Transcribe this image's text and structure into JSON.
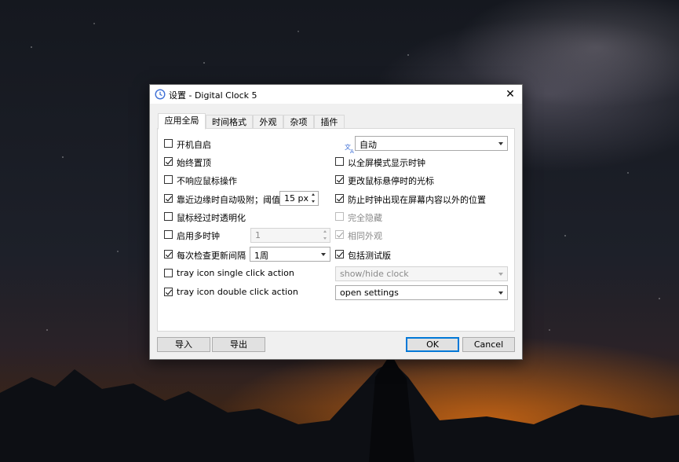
{
  "window": {
    "title": "设置 - Digital Clock 5",
    "close_glyph": "✕"
  },
  "tabs": [
    {
      "label": "应用全局",
      "active": true
    },
    {
      "label": "时间格式",
      "active": false
    },
    {
      "label": "外观",
      "active": false
    },
    {
      "label": "杂项",
      "active": false
    },
    {
      "label": "插件",
      "active": false
    }
  ],
  "left": {
    "autostart": {
      "label": "开机自启",
      "checked": false
    },
    "always_on_top": {
      "label": "始终置顶",
      "checked": true
    },
    "ignore_mouse": {
      "label": "不响应鼠标操作",
      "checked": false
    },
    "snap_to_edge": {
      "label": "靠近边缘时自动吸附；阈值",
      "checked": true,
      "threshold": "15 px"
    },
    "hover_transparent": {
      "label": "鼠标经过时透明化",
      "checked": false
    },
    "multi_clock": {
      "label": "启用多时钟",
      "checked": false,
      "count": "1"
    },
    "check_updates": {
      "label": "每次检查更新间隔",
      "checked": true,
      "interval": "1周"
    },
    "tray_single": {
      "label": "tray icon single click action",
      "checked": false
    },
    "tray_double": {
      "label": "tray icon double click action",
      "checked": true
    }
  },
  "right": {
    "language": {
      "value": "自动"
    },
    "fullscreen_show": {
      "label": "以全屏模式显示时钟",
      "checked": false
    },
    "change_cursor": {
      "label": "更改鼠标悬停时的光标",
      "checked": true
    },
    "keep_on_screen": {
      "label": "防止时钟出现在屏幕内容以外的位置",
      "checked": true
    },
    "fully_hide": {
      "label": "完全隐藏",
      "checked": false,
      "disabled": true
    },
    "same_appearance": {
      "label": "相同外观",
      "checked": true,
      "disabled": true
    },
    "include_beta": {
      "label": "包括测试版",
      "checked": true
    },
    "tray_single_action": {
      "value": "show/hide clock",
      "disabled": true
    },
    "tray_double_action": {
      "value": "open settings"
    }
  },
  "buttons": {
    "import": "导入",
    "export": "导出",
    "ok": "OK",
    "cancel": "Cancel"
  },
  "colors": {
    "accent": "#0078d7",
    "title_icon": "#3d6fd6"
  }
}
